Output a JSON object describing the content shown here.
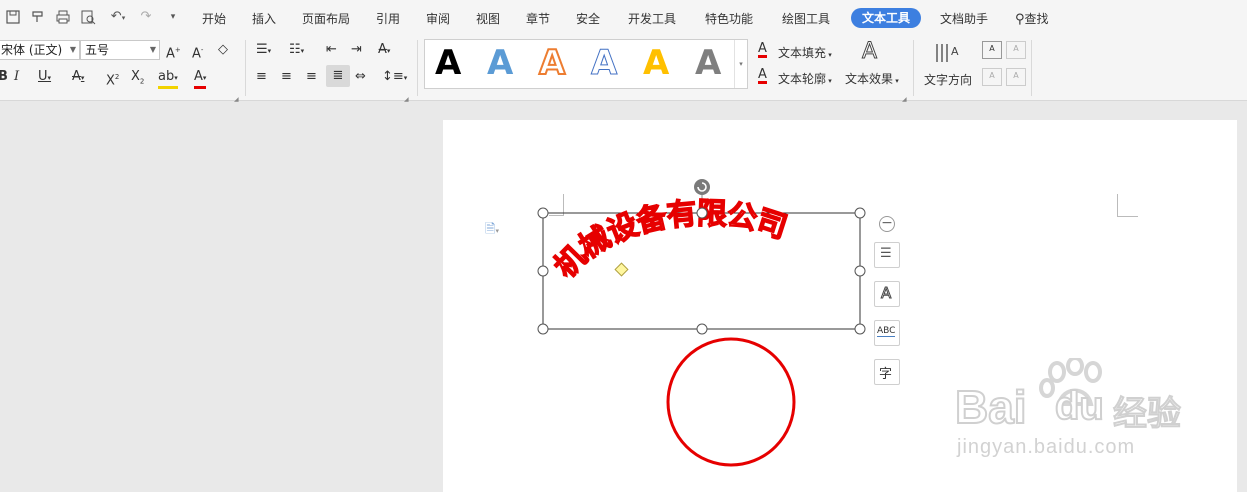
{
  "menubar": {
    "tabs": [
      "开始",
      "插入",
      "页面布局",
      "引用",
      "审阅",
      "视图",
      "章节",
      "安全",
      "开发工具",
      "特色功能",
      "绘图工具",
      "文本工具",
      "文档助手"
    ],
    "active_tab": "文本工具",
    "search_label": "查找"
  },
  "ribbon": {
    "font_name": "宋体 (正文)",
    "font_size": "五号",
    "text_fill_label": "文本填充",
    "text_outline_label": "文本轮廓",
    "text_effect_label": "文本效果",
    "text_direction_label": "文字方向",
    "gallery_letter": "A"
  },
  "document": {
    "arc_text": "机械设备有限公司",
    "arc_color": "#e60000",
    "circle_color": "#e60000"
  },
  "watermark": {
    "brand": "Bai",
    "brand2": "du",
    "cn": "经验",
    "url": "jingyan.baidu.com"
  }
}
